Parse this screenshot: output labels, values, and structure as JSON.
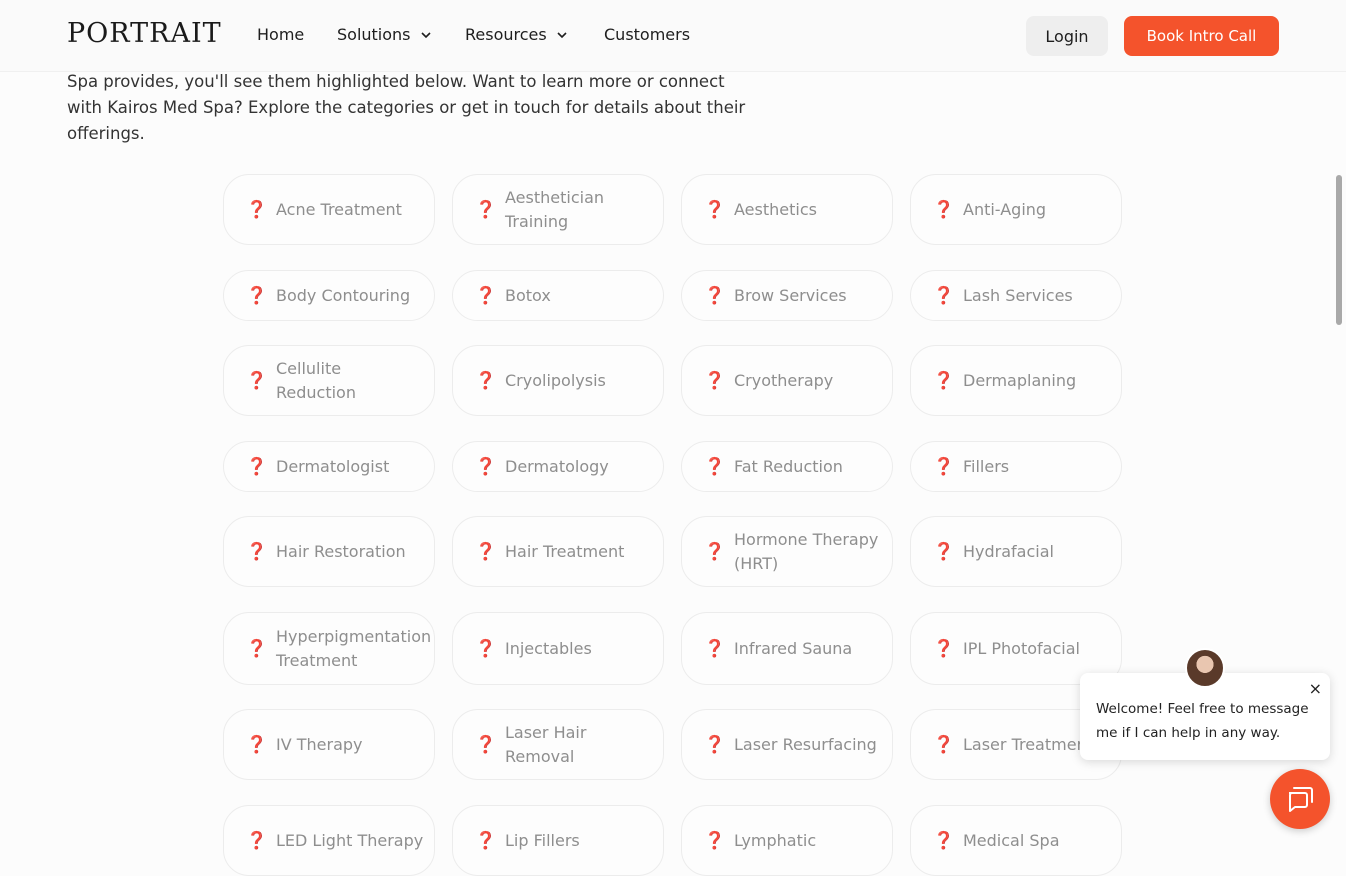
{
  "nav": {
    "logo": "PORTRAIT",
    "links": [
      "Home",
      "Solutions",
      "Resources",
      "Customers"
    ],
    "login": "Login",
    "cta": "Book Intro Call"
  },
  "intro": {
    "lines": [
      "Spa provides, you'll see them highlighted below. Want to learn more or connect",
      "with Kairos Med Spa? Explore the categories or get in touch for details about their",
      "offerings."
    ]
  },
  "category_icon": "❓",
  "categories": [
    "Acne Treatment",
    "Aesthetician Training",
    "Aesthetics",
    "Anti-Aging",
    "Body Contouring",
    "Botox",
    "Brow Services",
    "Lash Services",
    "Cellulite Reduction",
    "Cryolipolysis",
    "Cryotherapy",
    "Dermaplaning",
    "Dermatologist",
    "Dermatology",
    "Fat Reduction",
    "Fillers",
    "Hair Restoration",
    "Hair Treatment",
    "Hormone Therapy (HRT)",
    "Hydrafacial",
    "Hyperpigmentation Treatment",
    "Injectables",
    "Infrared Sauna",
    "IPL Photofacial",
    "IV Therapy",
    "Laser Hair Removal",
    "Laser Resurfacing",
    "Laser Treatment",
    "LED Light Therapy",
    "Lip Fillers",
    "Lymphatic",
    "Medical Spa"
  ],
  "chat": {
    "message": "Welcome! Feel free to message me if I can help in any way.",
    "close": "×"
  },
  "colors": {
    "accent": "#f4532c",
    "icon": "#e8554a"
  }
}
